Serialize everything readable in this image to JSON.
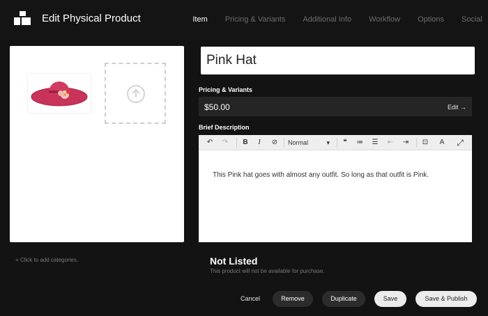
{
  "header": {
    "title": "Edit Physical Product",
    "logo_icon": "stacked-boxes-icon",
    "tabs": [
      {
        "label": "Item",
        "active": true
      },
      {
        "label": "Pricing & Variants",
        "active": false
      },
      {
        "label": "Additional Info",
        "active": false
      },
      {
        "label": "Workflow",
        "active": false
      },
      {
        "label": "Options",
        "active": false
      },
      {
        "label": "Social",
        "active": false
      }
    ]
  },
  "media": {
    "thumbnail_icon": "pink-hat-image",
    "upload_icon": "upload-arrow-icon",
    "categories_label": "+ Click to add categories."
  },
  "product": {
    "name": "Pink Hat"
  },
  "pricing": {
    "label": "Pricing & Variants",
    "price": "$50.00",
    "edit_label": "Edit →"
  },
  "description": {
    "label": "Brief Description",
    "format_value": "Normal",
    "text": "This Pink hat goes with almost any outfit. So long as that outfit is Pink.",
    "toolbar": {
      "undo": "↶",
      "redo": "↷",
      "bold": "B",
      "italic": "I",
      "clear": "⊘",
      "quote": "❝",
      "ordered": "≔",
      "unordered": "☰",
      "outdent": "⇤",
      "indent": "⇥",
      "embed": "⊡",
      "font": "A",
      "fullscreen": "⤢",
      "dropdown": "▾"
    }
  },
  "status": {
    "title": "Not Listed",
    "description": "This product will not be available for purchase."
  },
  "actions": {
    "cancel": "Cancel",
    "remove": "Remove",
    "duplicate": "Duplicate",
    "save": "Save",
    "save_publish": "Save & Publish"
  },
  "colors": {
    "background": "#131313",
    "hat": "#c8335a",
    "flower": "#f4c9b8"
  }
}
